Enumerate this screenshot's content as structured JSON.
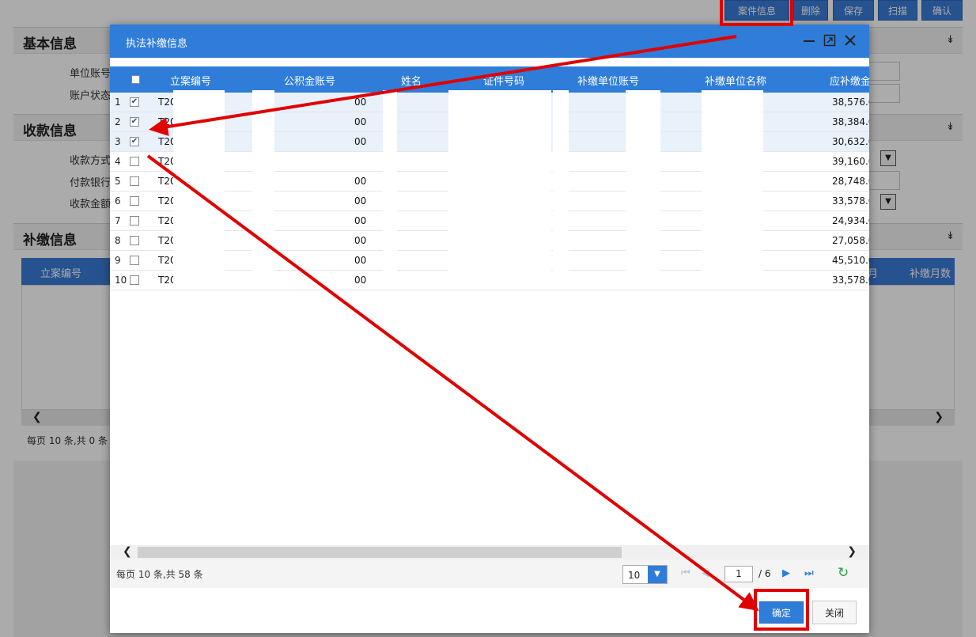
{
  "background": {
    "toolbar": [
      "案件信息",
      "删除",
      "保存",
      "扫描",
      "确认"
    ],
    "sections": [
      {
        "title": "基本信息",
        "fields": [
          "单位账号",
          "账户状态"
        ]
      },
      {
        "title": "收款信息",
        "fields": [
          "收款方式",
          "付款银行",
          "收款金额"
        ]
      },
      {
        "title": "补缴信息"
      }
    ],
    "grid_headers": [
      "立案编号",
      "月",
      "补缴月数"
    ],
    "pager_text": "每页 10 条,共 0 条",
    "expand_icon": "chevron-double-down-icon"
  },
  "dialog": {
    "title": "执法补缴信息",
    "controls": [
      "minimize-icon",
      "maximize-icon",
      "close-icon"
    ],
    "columns": [
      "立案编号",
      "公积金账号",
      "姓名",
      "证件号码",
      "补缴单位账号",
      "补缴单位名称",
      "应补缴金"
    ],
    "rows": [
      {
        "n": "1",
        "checked": true,
        "case": "T20",
        "mid": "00",
        "amount": "38,576.0"
      },
      {
        "n": "2",
        "checked": true,
        "case": "T20",
        "mid": "00",
        "amount": "38,384.0"
      },
      {
        "n": "3",
        "checked": true,
        "case": "T20",
        "mid": "00",
        "amount": "30,632.0"
      },
      {
        "n": "4",
        "checked": false,
        "case": "T20",
        "mid": "",
        "amount": "39,160.0"
      },
      {
        "n": "5",
        "checked": false,
        "case": "T20",
        "mid": "00",
        "amount": "28,748.0"
      },
      {
        "n": "6",
        "checked": false,
        "case": "T20",
        "mid": "00",
        "amount": "33,578.0"
      },
      {
        "n": "7",
        "checked": false,
        "case": "T20",
        "mid": "00",
        "amount": "24,934.0"
      },
      {
        "n": "8",
        "checked": false,
        "case": "T20",
        "mid": "00",
        "amount": "27,058.0"
      },
      {
        "n": "9",
        "checked": false,
        "case": "T20",
        "mid": "00",
        "amount": "45,510.0"
      },
      {
        "n": "10",
        "checked": false,
        "case": "T20",
        "mid": "00",
        "amount": "33,578.0"
      }
    ],
    "pager": {
      "summary": "每页 10 条,共 58 条",
      "page_size": "10",
      "current_page": "1",
      "total_pages": "/ 6"
    },
    "buttons": {
      "ok": "确定",
      "close": "关闭"
    }
  },
  "annotations": {
    "color": "#e00000",
    "highlighted": [
      "案件信息",
      "确定"
    ]
  }
}
